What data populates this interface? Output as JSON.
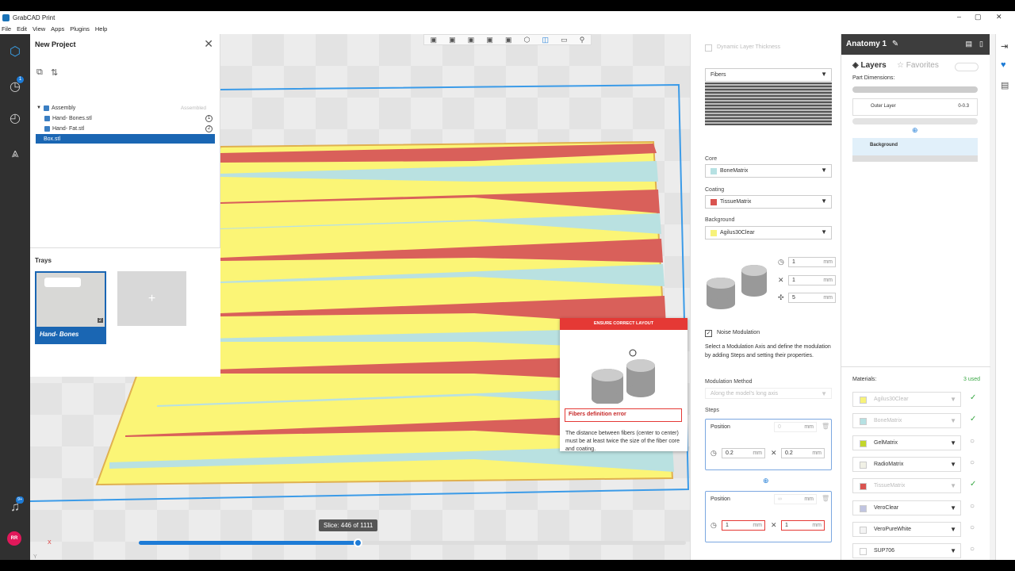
{
  "app": {
    "title": "GrabCAD Print",
    "window_controls": [
      "–",
      "▢",
      "✕"
    ]
  },
  "menu": [
    "File",
    "Edit",
    "View",
    "Apps",
    "Plugins",
    "Help"
  ],
  "leftnav": {
    "badges": {
      "history": "1",
      "notifications": "9+"
    },
    "avatar": "RR"
  },
  "project": {
    "title": "New Project",
    "close": "✕",
    "tree": [
      {
        "label": "Assembly",
        "status": "Assembled"
      },
      {
        "label": "Hand- Bones.stl",
        "num": "1"
      },
      {
        "label": "Hand- Fat.stl",
        "num": "2"
      },
      {
        "label": "Box.stl"
      }
    ],
    "trays_label": "Trays",
    "tray_name": "Hand- Bones",
    "tray_count": "2",
    "add_tray": "+"
  },
  "viewport": {
    "slice_label": "Slice: 446 of 1111",
    "slice_progress": 0.402,
    "axis_x": "X",
    "axis_y": "Y"
  },
  "popup": {
    "header": "ENSURE CORRECT LAYOUT",
    "error": "Fibers definition error",
    "message": "The distance between fibers (center to center) must be at least twice the size of the fiber core and coating."
  },
  "props": {
    "dynamic_layer": "Dynamic Layer Thickness",
    "pattern": "Fibers",
    "core_label": "Core",
    "core_value": "BoneMatrix",
    "coating_label": "Coating",
    "coating_value": "TissueMatrix",
    "background_label": "Background",
    "background_value": "Agilus30Clear",
    "fiber_params": [
      {
        "value": "1",
        "unit": "mm"
      },
      {
        "value": "1",
        "unit": "mm"
      },
      {
        "value": "5",
        "unit": "mm"
      }
    ],
    "noise_label": "Noise Modulation",
    "noise_desc": "Select a Modulation Axis and define the modulation by adding Steps and setting their properties.",
    "method_label": "Modulation Method",
    "method_value": "Along the model's long axis",
    "steps_label": "Steps",
    "step1": {
      "label": "Position",
      "pos": "0",
      "unit": "mm",
      "a": "0.2",
      "b": "0.2"
    },
    "step2": {
      "label": "Position",
      "pos": "∞",
      "unit": "mm",
      "a": "1",
      "b": "1"
    }
  },
  "anatomy": {
    "title": "Anatomy 1",
    "tab_layers": "Layers",
    "tab_favorites": "Favorites",
    "part_dim": "Part Dimensions:",
    "outer_layer": "Outer Layer",
    "outer_val": "0-0.3",
    "background": "Background",
    "materials_label": "Materials:",
    "materials_used": "3 used",
    "materials": [
      {
        "name": "Agilus30Clear",
        "color": "#f7f27a",
        "state": "check",
        "dim": true
      },
      {
        "name": "BoneMatrix",
        "color": "#b6e1e3",
        "state": "check",
        "dim": true
      },
      {
        "name": "GelMatrix",
        "color": "#c3d62b",
        "state": "circle",
        "dim": false
      },
      {
        "name": "RadioMatrix",
        "color": "#f1f1e6",
        "state": "circle",
        "dim": false
      },
      {
        "name": "TissueMatrix",
        "color": "#d9534f",
        "state": "check",
        "dim": true
      },
      {
        "name": "VeroClear",
        "color": "#c0c4e0",
        "state": "circle",
        "dim": false
      },
      {
        "name": "VeroPureWhite",
        "color": "#f4f4f4",
        "state": "circle",
        "dim": false
      },
      {
        "name": "SUP706",
        "color": "#ffffff",
        "state": "circle",
        "dim": false
      }
    ]
  }
}
